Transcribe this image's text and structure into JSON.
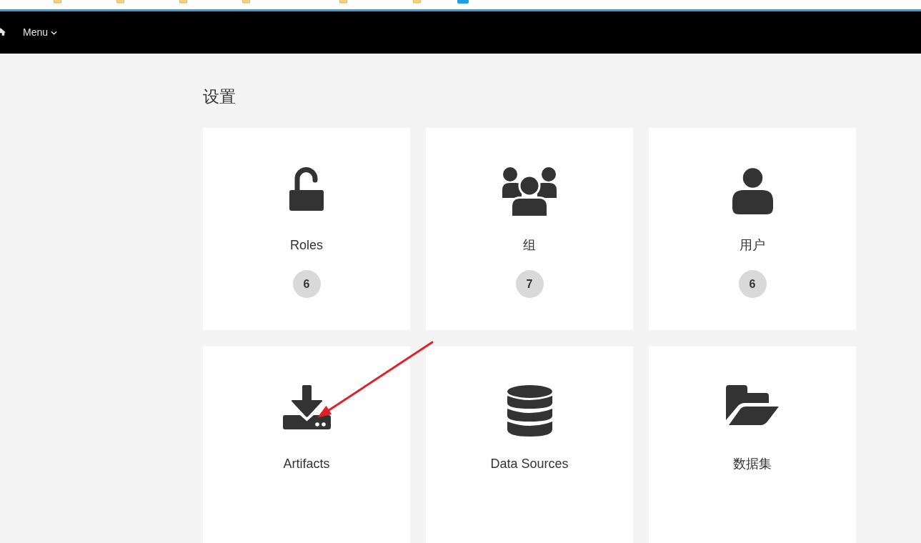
{
  "navbar": {
    "menu": "Menu"
  },
  "title": "设置",
  "tiles": [
    {
      "kind": "lock",
      "label": "Roles",
      "count": "6"
    },
    {
      "kind": "group",
      "label": "组",
      "count": "7"
    },
    {
      "kind": "user",
      "label": "用户",
      "count": "6"
    },
    {
      "kind": "download",
      "label": "Artifacts"
    },
    {
      "kind": "database",
      "label": "Data Sources"
    },
    {
      "kind": "folder",
      "label": "数据集"
    }
  ]
}
